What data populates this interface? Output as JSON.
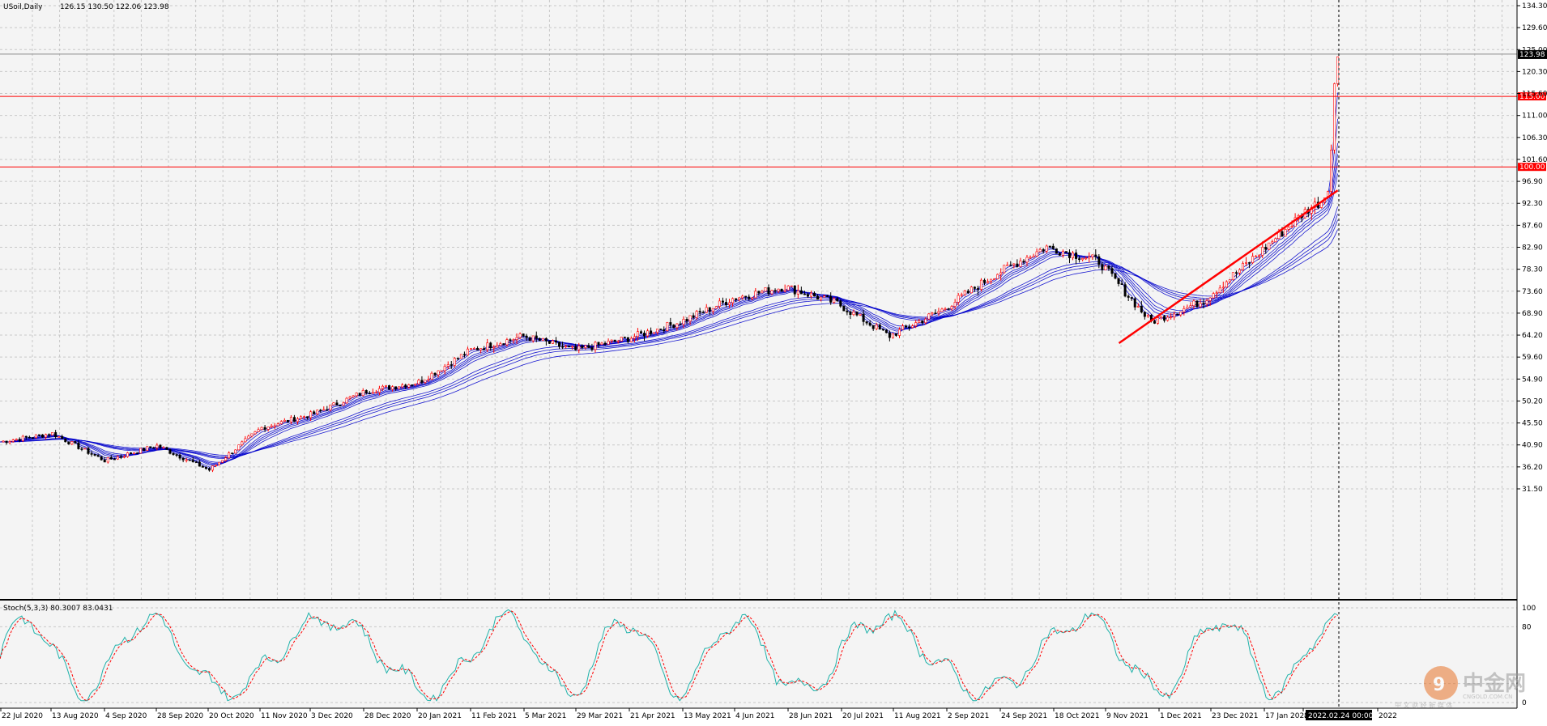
{
  "window": {
    "symbol_label": "USoil,Daily",
    "ohlc": "126.15 130.50 122.06 123.98"
  },
  "chart_data": [
    {
      "type": "candlestick",
      "title": "USoil,Daily",
      "ylim": [
        31.5,
        134.3
      ],
      "y_ticks": [
        "134.30",
        "129.60",
        "125.00",
        "120.30",
        "115.60",
        "111.00",
        "106.30",
        "101.60",
        "96.90",
        "92.30",
        "87.60",
        "82.90",
        "78.30",
        "73.60",
        "68.90",
        "64.20",
        "59.60",
        "54.90",
        "50.20",
        "45.50",
        "40.90",
        "36.20",
        "31.50"
      ],
      "x_ticks": [
        "22 Jul 2020",
        "13 Aug 2020",
        "4 Sep 2020",
        "28 Sep 2020",
        "20 Oct 2020",
        "11 Nov 2020",
        "3 Dec 2020",
        "28 Dec 2020",
        "20 Jan 2021",
        "11 Feb 2021",
        "5 Mar 2021",
        "29 Mar 2021",
        "21 Apr 2021",
        "13 May 2021",
        "4 Jun 2021",
        "28 Jun 2021",
        "20 Jul 2021",
        "11 Aug 2021",
        "2 Sep 2021",
        "24 Sep 2021",
        "18 Oct 2021",
        "9 Nov 2021",
        "1 Dec 2021",
        "23 Dec 2021",
        "17 Jan 2022",
        "8",
        "2022"
      ],
      "crosshair_label": "2022.02.24 00:00",
      "grid": true,
      "series": [
        {
          "name": "price_path",
          "x": [
            0,
            0.0345,
            0.069,
            0.1034,
            0.1379,
            0.1724,
            0.2069,
            0.2414,
            0.2759,
            0.3103,
            0.3448,
            0.3793,
            0.4138,
            0.4483,
            0.4828,
            0.5172,
            0.5517,
            0.5862,
            0.6207,
            0.6552,
            0.6897,
            0.7241,
            0.7586,
            0.7931,
            0.8276,
            0.8621,
            0.8722,
            0.8764,
            0.8798,
            0.8818
          ],
          "values": [
            41.5,
            43.3,
            37.5,
            40.7,
            35.5,
            44.5,
            47.5,
            52.3,
            54.2,
            61.0,
            64.0,
            61.0,
            63.5,
            67.0,
            72.0,
            74.5,
            71.0,
            64.0,
            69.5,
            77.0,
            83.0,
            80.0,
            67.0,
            71.5,
            81.0,
            91.0,
            93.0,
            97.0,
            118.0,
            124.0
          ]
        }
      ],
      "horizontal_levels": [
        {
          "label": "115.00",
          "value": 115.0,
          "color": "#ff0000"
        },
        {
          "label": "100.00",
          "value": 100.0,
          "color": "#ff0000"
        }
      ],
      "current_price": {
        "label": "123.98",
        "value": 123.98
      },
      "trendline": {
        "start": {
          "x": 0.7376,
          "value": 62.5
        },
        "end": {
          "x": 0.8818,
          "value": 95.0
        },
        "color": "#ff0000"
      },
      "moving_averages": {
        "count": 10,
        "color": "#0000cc"
      }
    },
    {
      "type": "line",
      "title": "Stoch(5,3,3) 80.3007 83.0431",
      "ylim": [
        0,
        100
      ],
      "y_ticks": [
        "100",
        "80",
        "0"
      ],
      "series": [
        {
          "name": "%K",
          "color": "#20b2aa"
        },
        {
          "name": "%D",
          "color": "#ff0000"
        }
      ]
    }
  ],
  "watermark": {
    "brand": "中金网",
    "domain": "CNGOLD.COM.CN",
    "tagline": "中 文 财 经 新 媒 体"
  },
  "colors": {
    "background": "#f4f4f4",
    "grid": "#c8c8c8",
    "bull_candle": "#ff0000",
    "bear_candle": "#000000",
    "ma_lines": "#0000cc",
    "level_lines": "#ff0000",
    "stoch_k": "#20b2aa",
    "stoch_d": "#ff0000"
  }
}
